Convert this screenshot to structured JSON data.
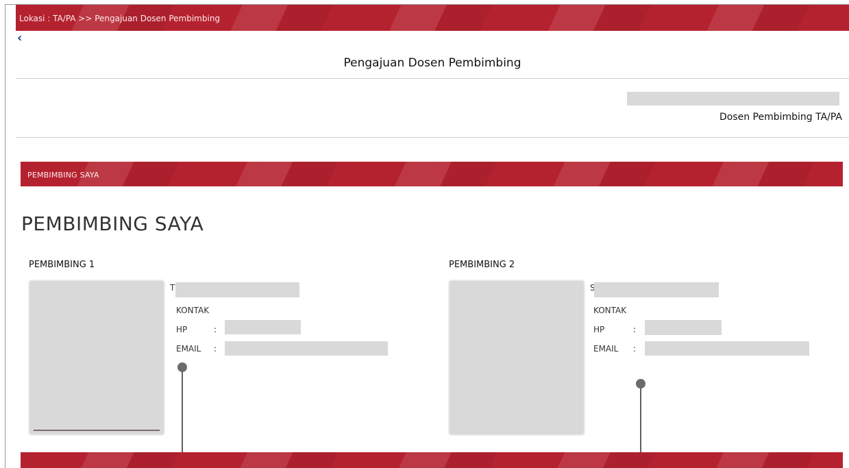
{
  "breadcrumb": {
    "text": "Lokasi : TA/PA >> Pengajuan Dosen Pembimbing"
  },
  "back_icon": "chevron-left-icon",
  "page_title": "Pengajuan Dosen Pembimbing",
  "dosen_label": "Dosen Pembimbing TA/PA",
  "section_band_label": "PEMBIMBING SAYA",
  "section_title": "PEMBIMBING SAYA",
  "pembimbing": [
    {
      "heading": "PEMBIMBING 1",
      "name_initial": "T",
      "kontak_label": "KONTAK",
      "hp_label": "HP",
      "email_label": "EMAIL",
      "colon": ":"
    },
    {
      "heading": "PEMBIMBING 2",
      "name_initial": "S",
      "kontak_label": "KONTAK",
      "hp_label": "HP",
      "email_label": "EMAIL",
      "colon": ":"
    }
  ],
  "colors": {
    "brand_red": "#b5222f",
    "redaction_gray": "#d9d9d9"
  }
}
